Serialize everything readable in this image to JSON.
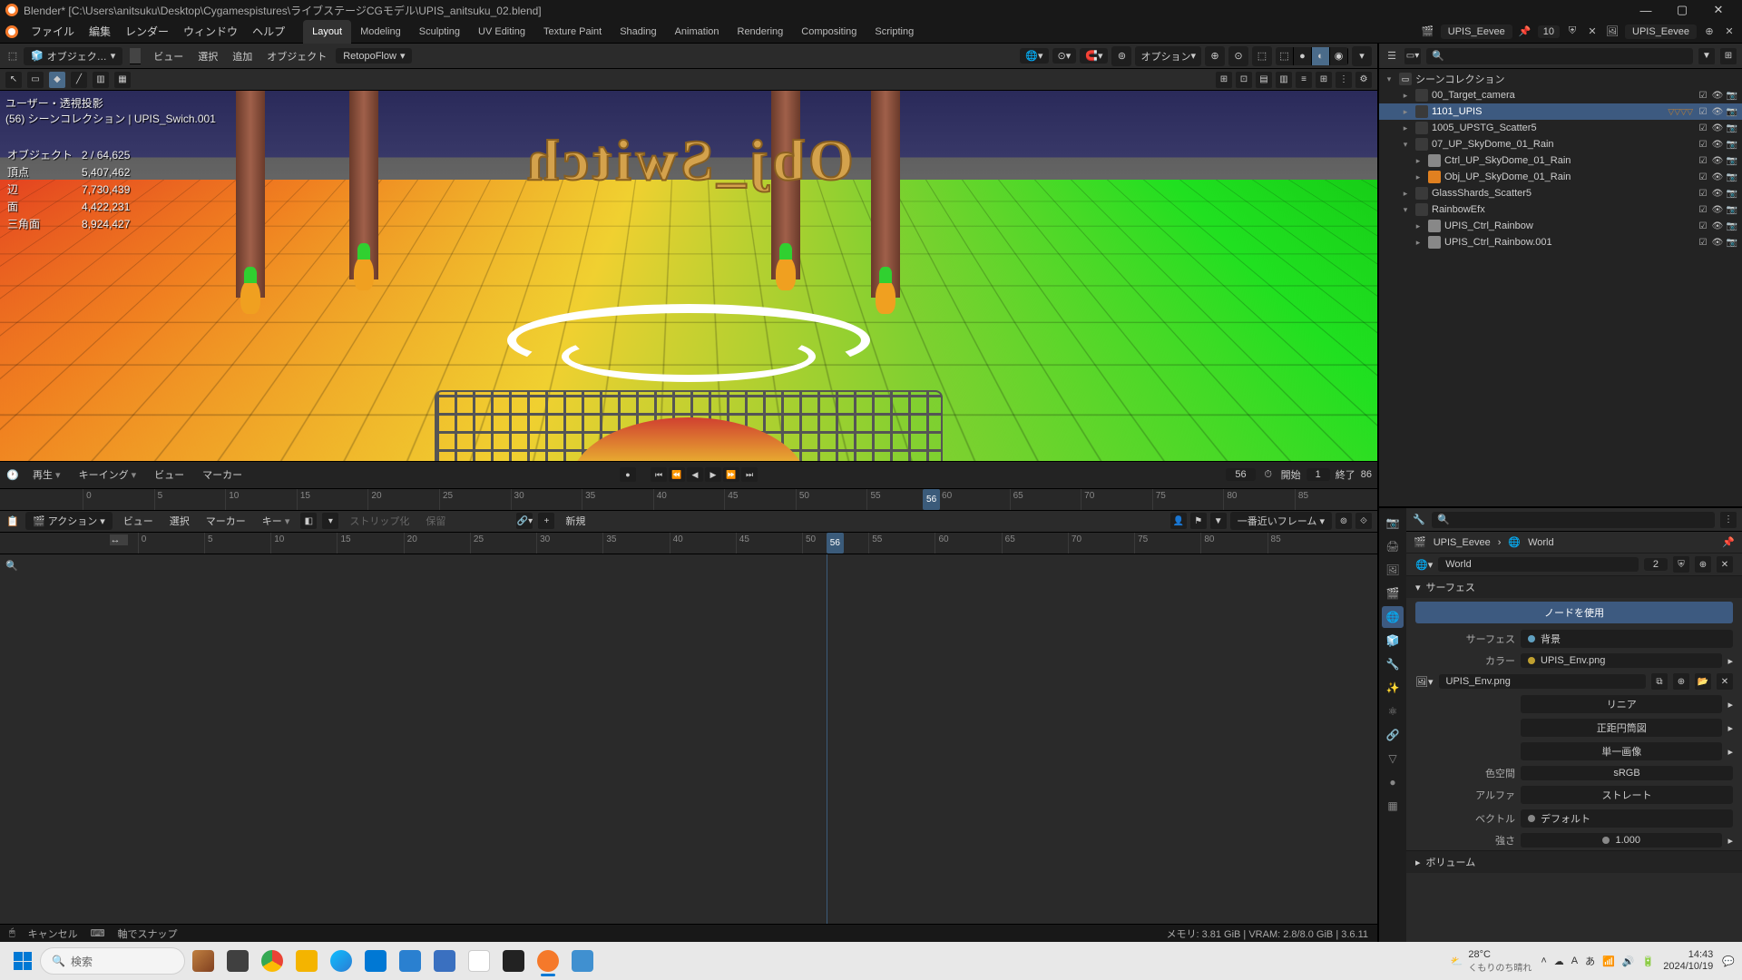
{
  "titlebar": {
    "title": "Blender* [C:\\Users\\anitsuku\\Desktop\\Cygamespistures\\ライブステージCGモデル\\UPIS_anitsuku_02.blend]"
  },
  "menubar": {
    "items": [
      "ファイル",
      "編集",
      "レンダー",
      "ウィンドウ",
      "ヘルプ"
    ],
    "workspaces": [
      "Layout",
      "Modeling",
      "Sculpting",
      "UV Editing",
      "Texture Paint",
      "Shading",
      "Animation",
      "Rendering",
      "Compositing",
      "Scripting"
    ],
    "active_workspace": 0,
    "scene": "UPIS_Eevee",
    "layer_num": "10",
    "view_layer": "UPIS_Eevee"
  },
  "vp_header": {
    "mode": "オブジェク…",
    "menus": [
      "ビュー",
      "選択",
      "追加",
      "オブジェクト"
    ],
    "retopo": "RetopoFlow",
    "options": "オプション"
  },
  "viewport": {
    "label_line1": "ユーザー・透視投影",
    "label_line2": "(56) シーンコレクション | UPIS_Swich.001",
    "mirror_text": "Obj_Switch",
    "stats": [
      {
        "k": "オブジェクト",
        "v": "2 / 64,625"
      },
      {
        "k": "頂点",
        "v": "5,407,462"
      },
      {
        "k": "辺",
        "v": "7,730,439"
      },
      {
        "k": "面",
        "v": "4,422,231"
      },
      {
        "k": "三角面",
        "v": "8,924,427"
      }
    ]
  },
  "timeline": {
    "menus": [
      "再生",
      "キーイング",
      "ビュー",
      "マーカー"
    ],
    "current": "56",
    "start_lbl": "開始",
    "start": "1",
    "end_lbl": "終了",
    "end": "86",
    "ticks": [
      0,
      5,
      10,
      15,
      20,
      25,
      30,
      35,
      40,
      45,
      50,
      55,
      60,
      65,
      70,
      75,
      80,
      85
    ]
  },
  "dope": {
    "mode": "アクション",
    "menus": [
      "ビュー",
      "選択",
      "マーカー",
      "キー"
    ],
    "strip": "ストリップ化",
    "hold": "保留",
    "new": "新規",
    "snap": "一番近いフレーム",
    "ticks": [
      0,
      5,
      10,
      15,
      20,
      25,
      30,
      35,
      40,
      45,
      50,
      55,
      60,
      65,
      70,
      75,
      80,
      85
    ]
  },
  "statusbar": {
    "left1": "キャンセル",
    "left2": "軸でスナップ",
    "right": "メモリ: 3.81 GiB | VRAM: 2.8/8.0 GiB | 3.6.11"
  },
  "outliner": {
    "root": "シーンコレクション",
    "items": [
      {
        "depth": 1,
        "expand": "▸",
        "ic": "coll",
        "label": "00_Target_camera",
        "sel": false
      },
      {
        "depth": 1,
        "expand": "▸",
        "ic": "coll",
        "label": "1101_UPIS",
        "sel": true,
        "badges": true
      },
      {
        "depth": 1,
        "expand": "▸",
        "ic": "coll",
        "label": "1005_UPSTG_Scatter5",
        "sel": false
      },
      {
        "depth": 1,
        "expand": "▾",
        "ic": "coll",
        "label": "07_UP_SkyDome_01_Rain",
        "sel": false
      },
      {
        "depth": 2,
        "expand": "▸",
        "ic": "empty",
        "label": "Ctrl_UP_SkyDome_01_Rain",
        "sel": false
      },
      {
        "depth": 2,
        "expand": "▸",
        "ic": "mesh",
        "label": "Obj_UP_SkyDome_01_Rain",
        "sel": false
      },
      {
        "depth": 1,
        "expand": "▸",
        "ic": "coll",
        "label": "GlassShards_Scatter5",
        "sel": false
      },
      {
        "depth": 1,
        "expand": "▾",
        "ic": "coll",
        "label": "RainbowEfx",
        "sel": false
      },
      {
        "depth": 2,
        "expand": "▸",
        "ic": "empty",
        "label": "UPIS_Ctrl_Rainbow",
        "sel": false
      },
      {
        "depth": 2,
        "expand": "▸",
        "ic": "empty",
        "label": "UPIS_Ctrl_Rainbow.001",
        "sel": false
      }
    ]
  },
  "props": {
    "breadcrumb_scene": "UPIS_Eevee",
    "breadcrumb_world": "World",
    "world_id": "World",
    "world_users": "2",
    "sec_surface": "サーフェス",
    "use_nodes": "ノードを使用",
    "surface_lbl": "サーフェス",
    "surface_val": "背景",
    "color_lbl": "カラー",
    "color_val": "UPIS_Env.png",
    "tex_id": "UPIS_Env.png",
    "linear": "リニア",
    "equirect": "正距円筒図",
    "single": "単一画像",
    "colorspace_lbl": "色空間",
    "colorspace_val": "sRGB",
    "alpha_lbl": "アルファ",
    "alpha_val": "ストレート",
    "vector_lbl": "ベクトル",
    "vector_val": "デフォルト",
    "strength_lbl": "強さ",
    "strength_val": "1.000",
    "volume": "ボリューム"
  },
  "taskbar": {
    "search_ph": "検索",
    "weather_temp": "28°C",
    "weather_desc": "くもりのち晴れ",
    "time": "14:43",
    "date": "2024/10/19"
  }
}
